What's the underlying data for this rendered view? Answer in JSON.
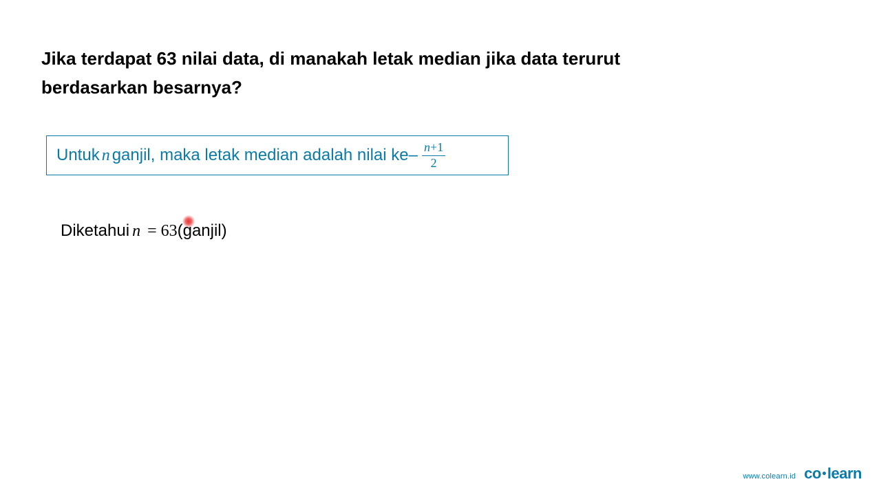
{
  "question": {
    "line1": "Jika terdapat 63 nilai data, di manakah letak median jika data terurut",
    "line2": "berdasarkan besarnya?"
  },
  "formula": {
    "prefix": "Untuk ",
    "var_n": "n",
    "mid": " ganjil, maka letak median adalah nilai ke– ",
    "frac_num_n": "n",
    "frac_num_plus1": "+1",
    "frac_den": "2"
  },
  "given": {
    "label": "Diketahui ",
    "var_n": "n",
    "equals": "=",
    "value": "63",
    "note": " (ganjil)"
  },
  "footer": {
    "url": "www.colearn.id",
    "logo_co": "co",
    "logo_learn": "learn"
  }
}
